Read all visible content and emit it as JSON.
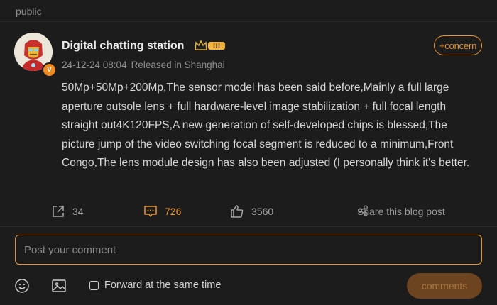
{
  "section_label": "public",
  "post": {
    "author": "Digital chatting station",
    "rank_badge": "III",
    "verified_badge": "V",
    "date": "24-12-24 08:04",
    "location": "Released in Shanghai",
    "follow_label": "+concern",
    "body": "50Mp+50Mp+200Mp,The sensor model has been said before,Mainly a full large aperture outsole lens + full hardware-level image stabilization + full focal length straight out4K120FPS,A new generation of self-developed chips is blessed,The picture jump of the video switching focal segment is reduced to a minimum,Front Congo,The lens module design has also been adjusted (I personally think it's better.",
    "actions": {
      "repost_count": "34",
      "comment_count": "726",
      "like_count": "3560",
      "share_label": "Share this blog post"
    }
  },
  "composer": {
    "placeholder": "Post your comment",
    "forward_label": "Forward at the same time",
    "forward_checked": false,
    "submit_label": "comments"
  },
  "colors": {
    "accent": "#e8952d",
    "background": "#1c1c1c",
    "submit_bg": "#6d4320"
  },
  "icons": [
    "emoji-icon",
    "image-icon",
    "repost-icon",
    "comment-icon",
    "like-icon",
    "share-icon",
    "crown-icon"
  ]
}
